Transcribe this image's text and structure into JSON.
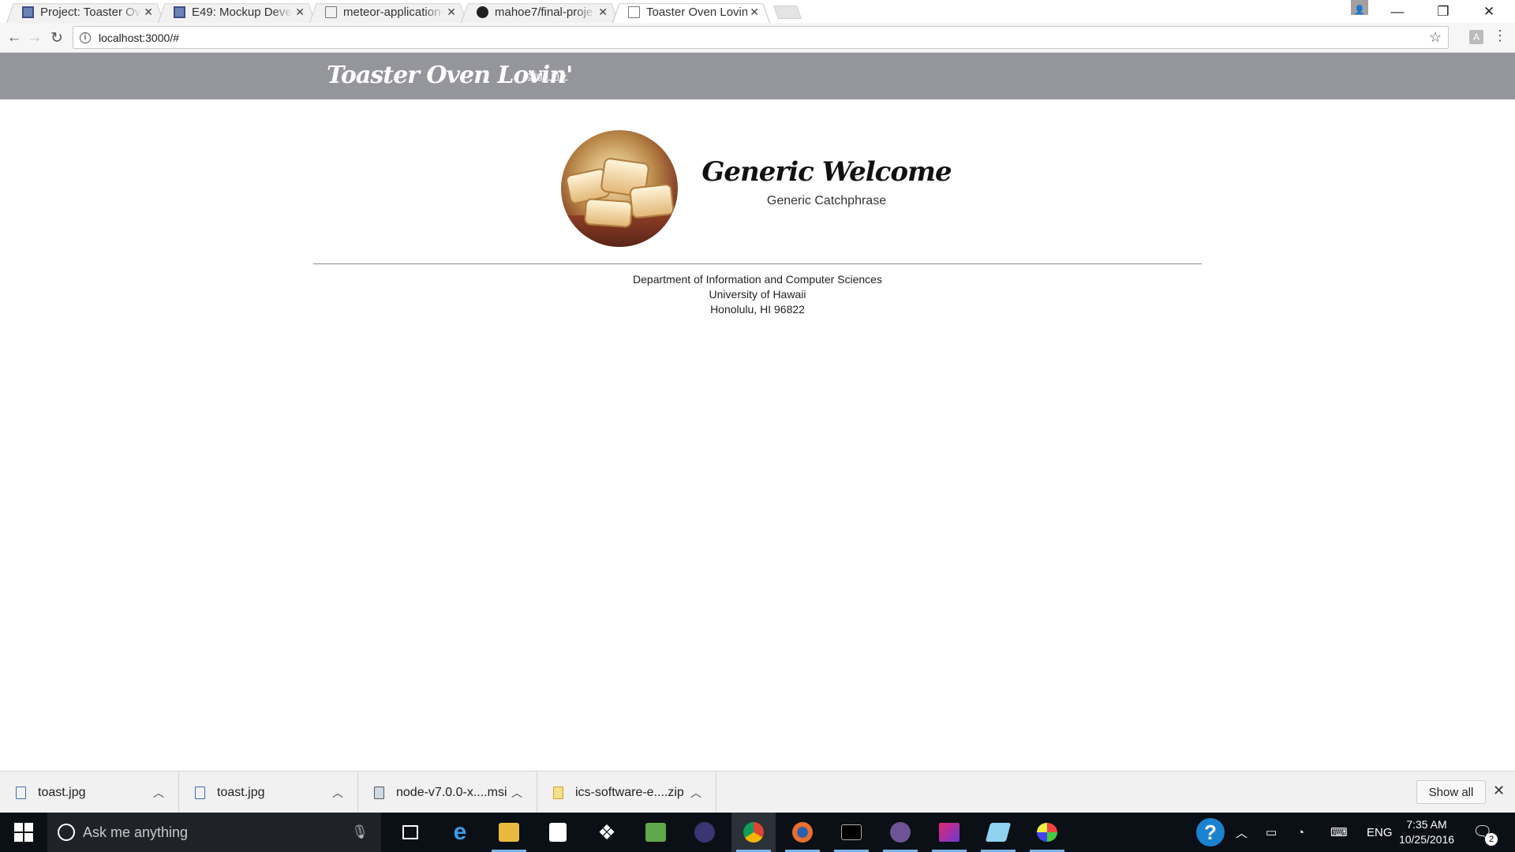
{
  "browser": {
    "tabs": [
      {
        "title": "Project: Toaster Ove",
        "icon": "project-icon",
        "active": false
      },
      {
        "title": "E49: Mockup Develo",
        "icon": "project-icon",
        "active": false
      },
      {
        "title": "meteor-application-",
        "icon": "document-icon",
        "active": false
      },
      {
        "title": "mahoe7/final-proje",
        "icon": "github-icon",
        "active": false
      },
      {
        "title": "Toaster Oven Lovin'",
        "icon": "document-icon",
        "active": true
      }
    ],
    "url": "localhost:3000/#"
  },
  "page": {
    "brand": "Toaster Oven Lovin'",
    "signin_label": "Sign in",
    "welcome_title": "Generic Welcome",
    "catchphrase": "Generic Catchphrase",
    "footer": {
      "line1": "Department of Information and Computer Sciences",
      "line2": "University of Hawaii",
      "line3": "Honolulu, HI 96822"
    },
    "colors": {
      "navbar": "#95959c"
    }
  },
  "downloads": {
    "items": [
      {
        "name": "toast.jpg",
        "icon": "image-file-icon"
      },
      {
        "name": "toast.jpg",
        "icon": "image-file-icon"
      },
      {
        "name": "node-v7.0.0-x....msi",
        "icon": "installer-icon"
      },
      {
        "name": "ics-software-e....zip",
        "icon": "zip-file-icon"
      }
    ],
    "show_all_label": "Show all"
  },
  "taskbar": {
    "search_placeholder": "Ask me anything",
    "language": "ENG",
    "time": "7:35 AM",
    "date": "10/25/2016",
    "notification_count": "2"
  }
}
